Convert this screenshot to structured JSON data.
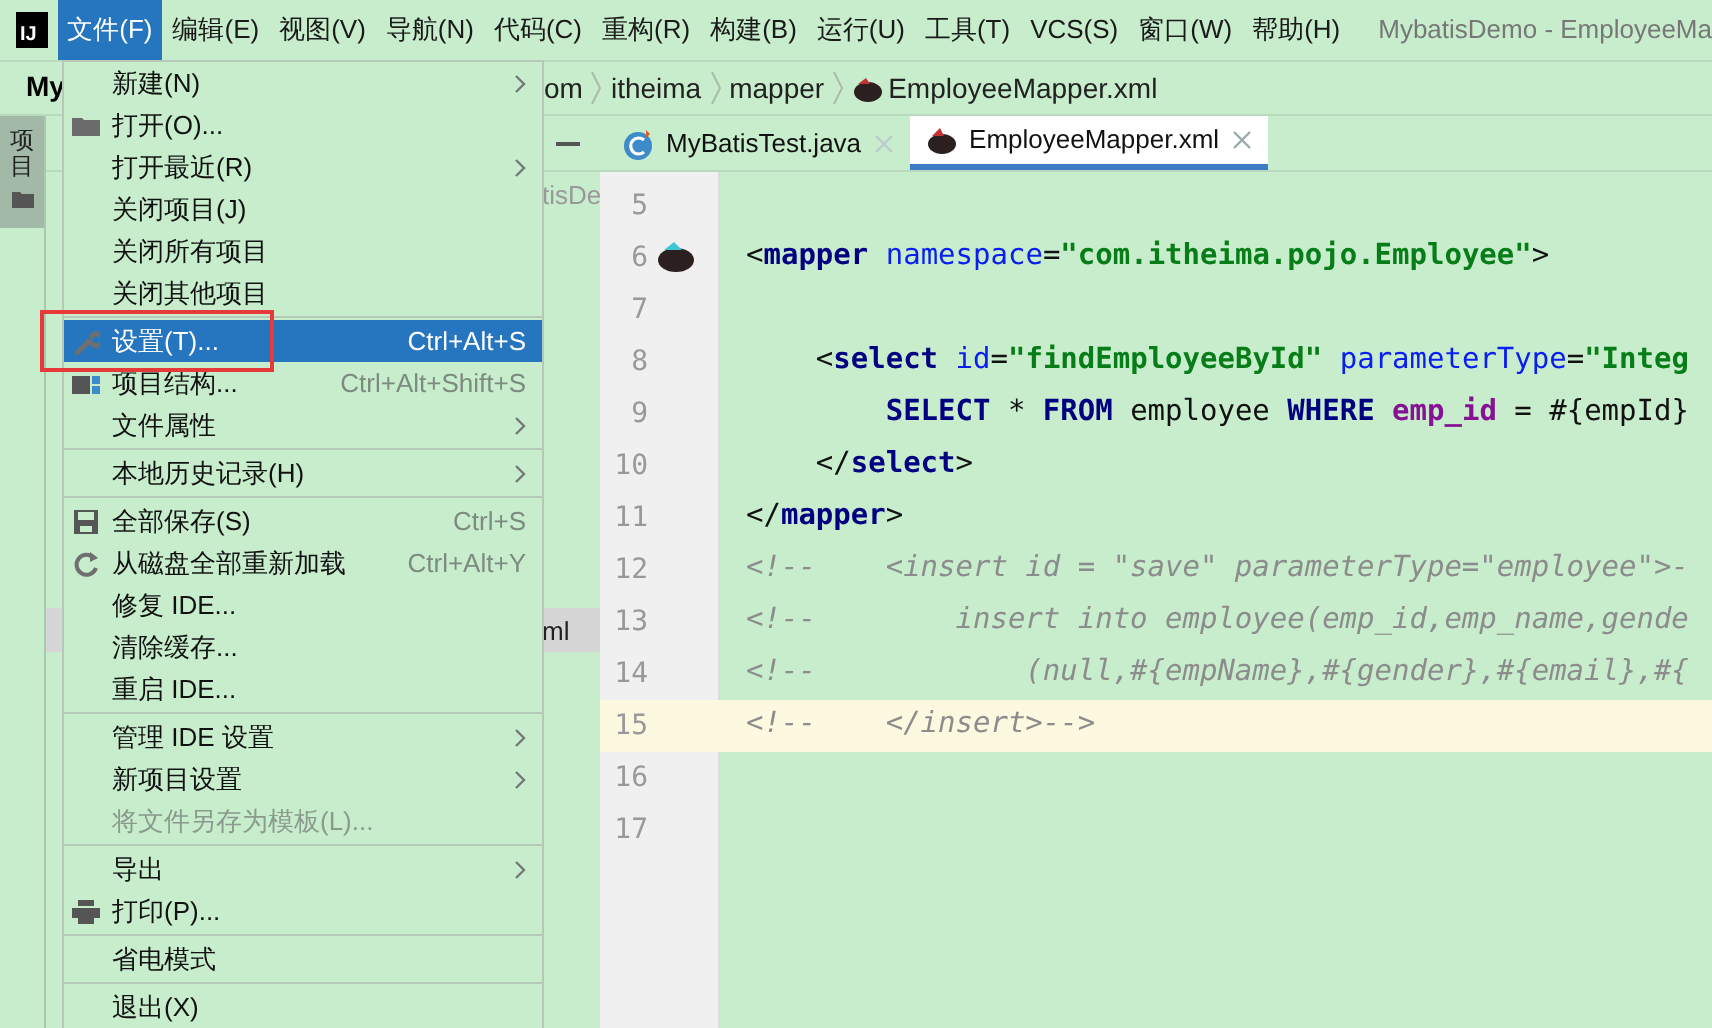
{
  "menubar": {
    "logo": "IJ",
    "items": [
      {
        "label": "文件(F)",
        "selected": true
      },
      {
        "label": "编辑(E)",
        "selected": false
      },
      {
        "label": "视图(V)",
        "selected": false
      },
      {
        "label": "导航(N)",
        "selected": false
      },
      {
        "label": "代码(C)",
        "selected": false
      },
      {
        "label": "重构(R)",
        "selected": false
      },
      {
        "label": "构建(B)",
        "selected": false
      },
      {
        "label": "运行(U)",
        "selected": false
      },
      {
        "label": "工具(T)",
        "selected": false
      },
      {
        "label": "VCS(S)",
        "selected": false
      },
      {
        "label": "窗口(W)",
        "selected": false
      },
      {
        "label": "帮助(H)",
        "selected": false
      }
    ],
    "title": "MybatisDemo - EmployeeMa"
  },
  "project_label": "My",
  "breadcrumbs": [
    "om",
    "itheima",
    "mapper",
    "EmployeeMapper.xml"
  ],
  "tool_window_tab": {
    "label": "项目"
  },
  "project_pane": {
    "texts": [
      "tisDe",
      "ml"
    ]
  },
  "editor_tabs": [
    {
      "label": "MyBatisTest.java",
      "kind": "java",
      "selected": false
    },
    {
      "label": "EmployeeMapper.xml",
      "kind": "xml",
      "selected": true
    }
  ],
  "file_menu": {
    "groups": [
      [
        {
          "label": "新建(N)",
          "submenu": true,
          "selected": false,
          "disabled": false
        },
        {
          "label": "打开(O)...",
          "submenu": false,
          "selected": false,
          "disabled": false
        },
        {
          "label": "打开最近(R)",
          "submenu": true,
          "selected": false,
          "disabled": false
        },
        {
          "label": "关闭项目(J)",
          "submenu": false,
          "selected": false,
          "disabled": false
        },
        {
          "label": "关闭所有项目",
          "submenu": false,
          "selected": false,
          "disabled": false
        },
        {
          "label": "关闭其他项目",
          "submenu": false,
          "selected": false,
          "disabled": false
        }
      ],
      [
        {
          "label": "设置(T)...",
          "shortcut": "Ctrl+Alt+S",
          "submenu": false,
          "selected": true,
          "disabled": false
        },
        {
          "label": "项目结构...",
          "shortcut": "Ctrl+Alt+Shift+S",
          "submenu": false,
          "selected": false,
          "disabled": false
        },
        {
          "label": "文件属性",
          "submenu": true,
          "selected": false,
          "disabled": false
        }
      ],
      [
        {
          "label": "本地历史记录(H)",
          "submenu": true,
          "selected": false,
          "disabled": false
        }
      ],
      [
        {
          "label": "全部保存(S)",
          "shortcut": "Ctrl+S",
          "submenu": false,
          "selected": false,
          "disabled": false
        },
        {
          "label": "从磁盘全部重新加载",
          "shortcut": "Ctrl+Alt+Y",
          "submenu": false,
          "selected": false,
          "disabled": false
        },
        {
          "label": "修复 IDE...",
          "submenu": false,
          "selected": false,
          "disabled": false
        },
        {
          "label": "清除缓存...",
          "submenu": false,
          "selected": false,
          "disabled": false
        },
        {
          "label": "重启 IDE...",
          "submenu": false,
          "selected": false,
          "disabled": false
        }
      ],
      [
        {
          "label": "管理 IDE 设置",
          "submenu": true,
          "selected": false,
          "disabled": false
        },
        {
          "label": "新项目设置",
          "submenu": true,
          "selected": false,
          "disabled": false
        },
        {
          "label": "将文件另存为模板(L)...",
          "submenu": false,
          "selected": false,
          "disabled": true
        }
      ],
      [
        {
          "label": "导出",
          "submenu": true,
          "selected": false,
          "disabled": false
        },
        {
          "label": "打印(P)...",
          "submenu": false,
          "selected": false,
          "disabled": false
        }
      ],
      [
        {
          "label": "省电模式",
          "submenu": false,
          "selected": false,
          "disabled": false
        }
      ],
      [
        {
          "label": "退出(X)",
          "submenu": false,
          "selected": false,
          "disabled": false
        }
      ]
    ]
  },
  "editor": {
    "lines": [
      {
        "number": "5",
        "current": false,
        "gutter_marker": false
      },
      {
        "number": "6",
        "current": false,
        "gutter_marker": true,
        "tokens": [
          {
            "text": "<",
            "kind": "punct"
          },
          {
            "text": "mapper",
            "kind": "tag"
          },
          {
            "text": " namespace",
            "kind": "attr"
          },
          {
            "text": "=",
            "kind": "punct"
          },
          {
            "text": "\"com.itheima.pojo.Employee\"",
            "kind": "value"
          },
          {
            "text": ">",
            "kind": "punct"
          }
        ]
      },
      {
        "number": "7",
        "current": false,
        "gutter_marker": false
      },
      {
        "number": "8",
        "current": false,
        "gutter_marker": false,
        "tokens": [
          {
            "text": "    <",
            "kind": "punct"
          },
          {
            "text": "select",
            "kind": "tag"
          },
          {
            "text": " id",
            "kind": "attr"
          },
          {
            "text": "=",
            "kind": "punct"
          },
          {
            "text": "\"findEmployeeById\"",
            "kind": "value"
          },
          {
            "text": " parameterType",
            "kind": "attr"
          },
          {
            "text": "=",
            "kind": "punct"
          },
          {
            "text": "\"Integ",
            "kind": "value"
          }
        ]
      },
      {
        "number": "9",
        "current": false,
        "gutter_marker": false,
        "tokens": [
          {
            "text": "        SELECT",
            "kind": "keyword"
          },
          {
            "text": " * ",
            "kind": "plain"
          },
          {
            "text": "FROM",
            "kind": "keyword"
          },
          {
            "text": " employee ",
            "kind": "plain"
          },
          {
            "text": "WHERE",
            "kind": "keyword"
          },
          {
            "text": " emp_id",
            "kind": "column"
          },
          {
            "text": " = #{empId}",
            "kind": "plain"
          }
        ]
      },
      {
        "number": "10",
        "current": false,
        "gutter_marker": false,
        "tokens": [
          {
            "text": "    </",
            "kind": "punct"
          },
          {
            "text": "select",
            "kind": "tag"
          },
          {
            "text": ">",
            "kind": "punct"
          }
        ]
      },
      {
        "number": "11",
        "current": false,
        "gutter_marker": false,
        "tokens": [
          {
            "text": "</",
            "kind": "punct"
          },
          {
            "text": "mapper",
            "kind": "tag"
          },
          {
            "text": ">",
            "kind": "punct"
          }
        ]
      },
      {
        "number": "12",
        "current": false,
        "gutter_marker": false,
        "tokens": [
          {
            "text": "<!--    <insert id = \"save\" parameterType=\"employee\">-",
            "kind": "comment"
          }
        ]
      },
      {
        "number": "13",
        "current": false,
        "gutter_marker": false,
        "tokens": [
          {
            "text": "<!--        insert into employee(emp_id,emp_name,gende",
            "kind": "comment"
          }
        ]
      },
      {
        "number": "14",
        "current": false,
        "gutter_marker": false,
        "tokens": [
          {
            "text": "<!--            (null,#{empName},#{gender},#{email},#{",
            "kind": "comment"
          }
        ]
      },
      {
        "number": "15",
        "current": true,
        "gutter_marker": false,
        "tokens": [
          {
            "text": "<!--    </insert>-->",
            "kind": "comment"
          }
        ]
      },
      {
        "number": "16",
        "current": false,
        "gutter_marker": false
      },
      {
        "number": "17",
        "current": false,
        "gutter_marker": false
      }
    ]
  }
}
